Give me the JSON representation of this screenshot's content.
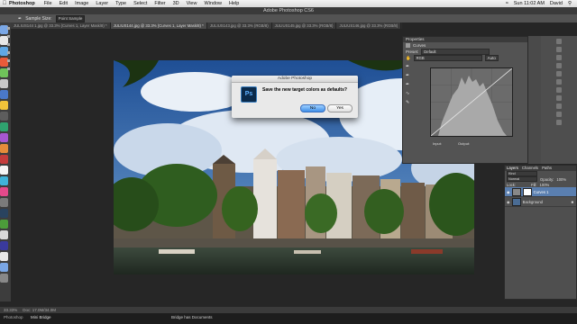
{
  "menubar": {
    "apple": "",
    "app": "Photoshop",
    "items": [
      "File",
      "Edit",
      "Image",
      "Layer",
      "Type",
      "Select",
      "Filter",
      "3D",
      "View",
      "Window",
      "Help"
    ],
    "clock": "Sun 11:02 AM",
    "user": "David"
  },
  "window_title": "Adobe Photoshop CS6",
  "options": {
    "sample_size_label": "Sample Size:",
    "sample_size_value": "Point Sample"
  },
  "tabs": [
    {
      "label": "JULIUS144 1.jpg @ 33.3% (Curves 1, Layer Mask/8) *",
      "active": false
    },
    {
      "label": "JULIUS144.jpg @ 33.3% (Curves 1, Layer Mask/8) *",
      "active": true
    },
    {
      "label": "JULIUS143.jpg @ 33.3% (RGB/8)",
      "active": false
    },
    {
      "label": "JULIUS145.jpg @ 33.3% (RGB/8)",
      "active": false
    },
    {
      "label": "JULIUS146.jpg @ 33.3% (RGB/8)",
      "active": false
    }
  ],
  "dialog": {
    "title": "Adobe Photoshop",
    "logo_text": "Ps",
    "message": "Save the new target colors as defaults?",
    "no_label": "No",
    "yes_label": "Yes"
  },
  "properties": {
    "title": "Properties",
    "panel_name": "Curves",
    "preset_label": "Preset:",
    "preset_value": "Default",
    "channel_value": "RGB",
    "auto_label": "Auto",
    "input_label": "Input:",
    "output_label": "Output:"
  },
  "layers": {
    "tabs": [
      "Layers",
      "Channels",
      "Paths"
    ],
    "kind_label": "Kind",
    "mode_value": "Normal",
    "opacity_label": "Opacity:",
    "opacity_value": "100%",
    "lock_label": "Lock:",
    "fill_label": "Fill:",
    "fill_value": "100%",
    "items": [
      {
        "name": "Curves 1",
        "selected": true
      },
      {
        "name": "Background",
        "selected": false
      }
    ]
  },
  "status": {
    "zoom": "33.33%",
    "doc": "Doc: 17.0M/34.0M"
  },
  "bottom_tabs": [
    "Photoshop",
    "Mini Bridge"
  ],
  "bridge_label": "Bridge has Documents",
  "colors": {
    "accent": "#3f8fe8",
    "panel": "#535353",
    "workspace": "#262626"
  }
}
